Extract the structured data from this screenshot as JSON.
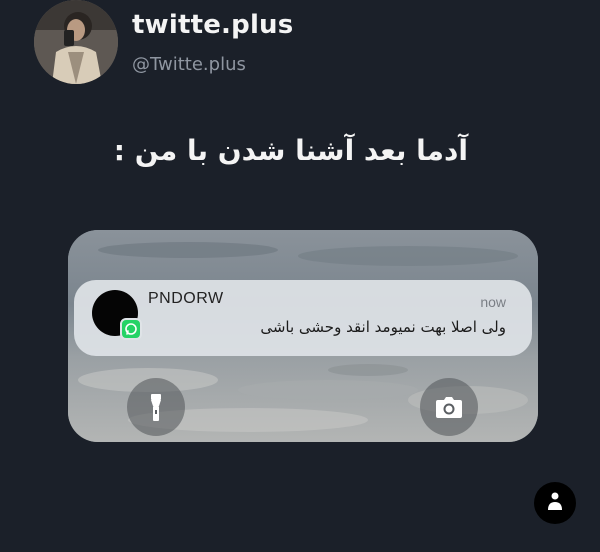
{
  "profile": {
    "display_name": "twitte.plus",
    "username": "@Twitte.plus",
    "avatar_icon": "profile-photo-person"
  },
  "post": {
    "text": "آدما بعد آشنا شدن با من :"
  },
  "lockscreen": {
    "notification": {
      "sender": "PNDORW",
      "time": "now",
      "message": "ولی اصلا بهت نمیومد انقد وحشی باشی",
      "app_icon": "whatsapp-icon"
    },
    "shortcuts": {
      "left_icon": "flashlight-icon",
      "right_icon": "camera-icon"
    }
  },
  "floating_button": {
    "icon": "accessibility-icon"
  },
  "colors": {
    "background": "#1b2029",
    "notification_bg": "#dee2e6",
    "whatsapp_green": "#25d366",
    "secondary_text": "#8f96a1"
  }
}
